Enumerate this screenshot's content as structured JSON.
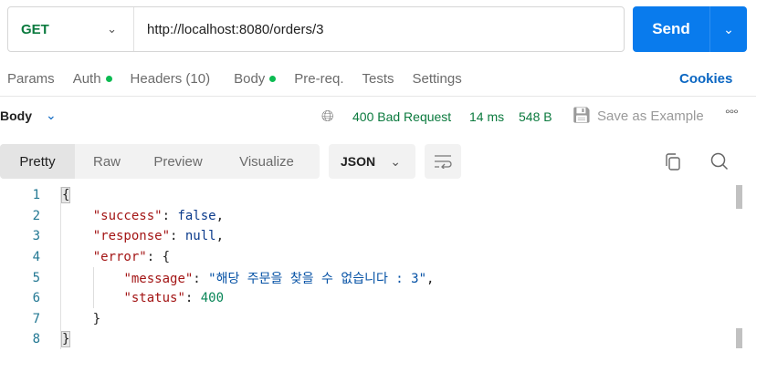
{
  "request": {
    "method": "GET",
    "url": "http://localhost:8080/orders/3",
    "send_label": "Send"
  },
  "tabs": [
    {
      "label": "Params",
      "dot": false
    },
    {
      "label": "Auth",
      "dot": true
    },
    {
      "label": "Headers (10)",
      "dot": false
    },
    {
      "label": "Body",
      "dot": true
    },
    {
      "label": "Pre-req.",
      "dot": false
    },
    {
      "label": "Tests",
      "dot": false
    },
    {
      "label": "Settings",
      "dot": false
    }
  ],
  "cookies_label": "Cookies",
  "response": {
    "section_label": "Body",
    "status": "400 Bad Request",
    "time": "14 ms",
    "size": "548 B",
    "save_label": "Save as Example"
  },
  "view_tabs": [
    "Pretty",
    "Raw",
    "Preview",
    "Visualize"
  ],
  "format": "JSON",
  "code_lines": [
    "1",
    "2",
    "3",
    "4",
    "5",
    "6",
    "7",
    "8"
  ],
  "body": {
    "k_success": "\"success\"",
    "v_success": "false",
    "k_response": "\"response\"",
    "v_response": "null",
    "k_error": "\"error\"",
    "k_message": "\"message\"",
    "v_message": "\"해당 주문을 찾을 수 없습니다 : 3\"",
    "k_status": "\"status\"",
    "v_status": "400"
  },
  "colors": {
    "accent": "#097bed",
    "success": "#0b7a3e",
    "dot": "#0cbb52"
  }
}
